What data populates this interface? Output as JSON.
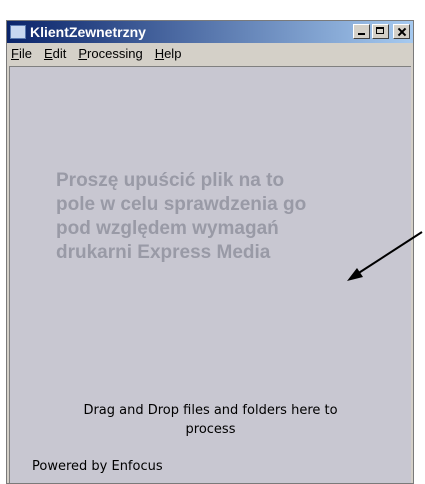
{
  "window": {
    "title": "KlientZewnetrzny",
    "controls": {
      "minimize": "minimize-icon",
      "maximize": "maximize-icon",
      "close": "close-icon"
    }
  },
  "menu": {
    "items": [
      {
        "first": "F",
        "rest": "ile"
      },
      {
        "first": "E",
        "rest": "dit"
      },
      {
        "first": "P",
        "rest": "rocessing"
      },
      {
        "first": "H",
        "rest": "elp"
      }
    ]
  },
  "drop_area": {
    "annotation_lines": [
      "Proszę upuścić plik na to",
      "pole w celu sprawdzenia go",
      "pod względem wymagań",
      "drukarni Express Media"
    ],
    "hint_line1": "Drag and Drop files and folders here to",
    "hint_line2": "process",
    "powered_by": "Powered by Enfocus"
  },
  "colors": {
    "title_start": "#0a246a",
    "title_end": "#a6caf0",
    "client_bg": "#c8c7d1",
    "annotation_text": "#999aa6"
  }
}
